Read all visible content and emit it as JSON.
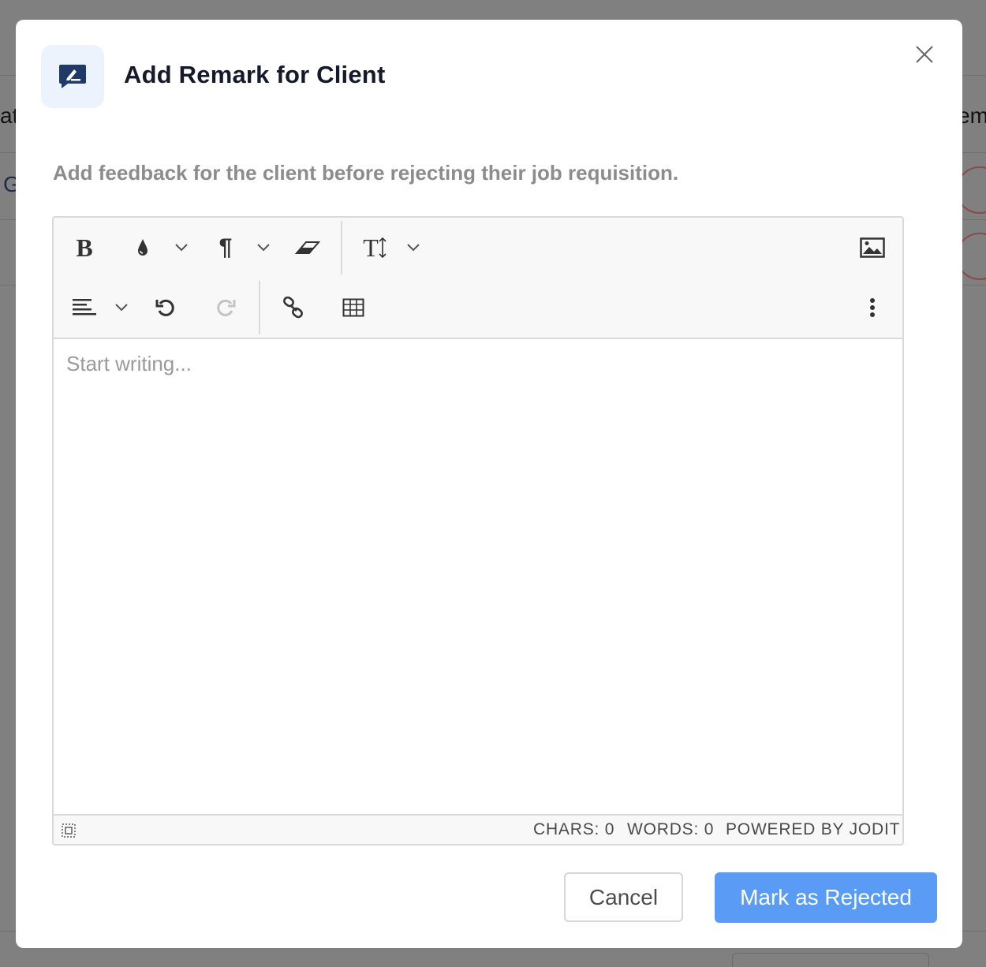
{
  "background": {
    "fragment_left_1": "at",
    "fragment_left_2": "G",
    "fragment_right_1": "em"
  },
  "modal": {
    "title": "Add Remark for Client",
    "description": "Add feedback for the client before rejecting their job requisition.",
    "icon": "edit-comment-icon",
    "accent_color": "#1f3a68"
  },
  "editor": {
    "placeholder": "Start writing...",
    "toolbar_row1": [
      {
        "name": "bold",
        "icon": "bold-icon",
        "label": "B"
      },
      {
        "name": "brush",
        "icon": "text-color-icon"
      },
      {
        "name": "paragraph",
        "icon": "paragraph-icon",
        "label": "¶"
      },
      {
        "name": "eraser",
        "icon": "eraser-icon"
      },
      {
        "name": "font-size",
        "icon": "font-size-icon",
        "label": "T"
      },
      {
        "name": "image",
        "icon": "image-icon"
      }
    ],
    "toolbar_row2": [
      {
        "name": "align",
        "icon": "align-left-icon"
      },
      {
        "name": "undo",
        "icon": "undo-icon"
      },
      {
        "name": "redo",
        "icon": "redo-icon"
      },
      {
        "name": "link",
        "icon": "link-icon"
      },
      {
        "name": "table",
        "icon": "table-icon"
      },
      {
        "name": "more",
        "icon": "more-vertical-icon"
      }
    ],
    "status": {
      "chars": "CHARS: 0",
      "words": "WORDS: 0",
      "powered_by": "POWERED BY JODIT"
    }
  },
  "actions": {
    "cancel_label": "Cancel",
    "reject_label": "Mark as Rejected",
    "reject_color": "#5a9cf5"
  }
}
